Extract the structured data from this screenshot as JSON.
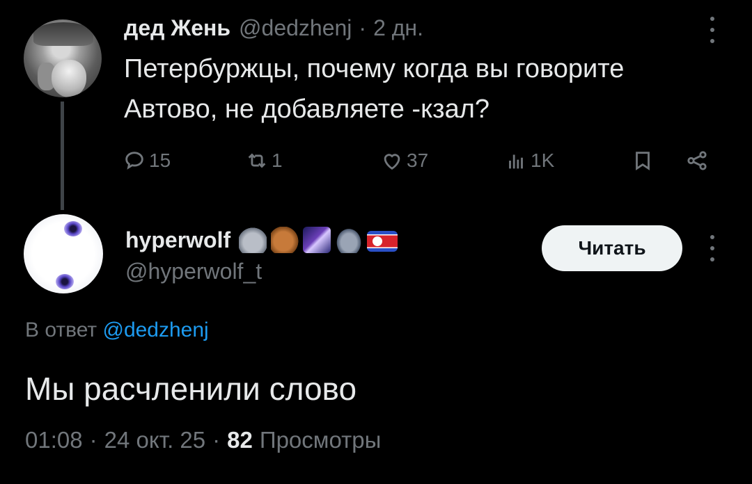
{
  "parent": {
    "author_name": "дед Жень",
    "handle": "@dedzhenj",
    "separator": "·",
    "time": "2 дн.",
    "text_lines": [
      "Петербуржцы, почему когда вы говорите",
      "Автово, не добавляете -кзал?"
    ],
    "actions": {
      "replies": "15",
      "reposts": "1",
      "likes": "37",
      "views": "1K"
    },
    "icons": [
      "reply-icon",
      "repost-icon",
      "like-icon",
      "views-icon",
      "bookmark-icon",
      "share-icon",
      "more-icon"
    ]
  },
  "reply": {
    "author_name": "hyperwolf",
    "name_emojis": [
      "wolf-emoji",
      "horse-emoji",
      "galaxy-emoji",
      "ufo-emoji",
      "north-korea-flag-emoji"
    ],
    "handle": "@hyperwolf_t",
    "follow_label": "Читать",
    "reply_to_prefix": "В ответ",
    "reply_to_mention": "@dedzhenj",
    "text": "Мы расчленили слово",
    "time": "01:08",
    "separator": "·",
    "date": "24 окт. 25",
    "views_count": "82",
    "views_label": "Просмотры"
  },
  "colors": {
    "background": "#000000",
    "text_primary": "#e7e9ea",
    "text_secondary": "#71767b",
    "link": "#1d9bf0",
    "button_bg": "#eff3f4",
    "thread_line": "#3f4448"
  }
}
